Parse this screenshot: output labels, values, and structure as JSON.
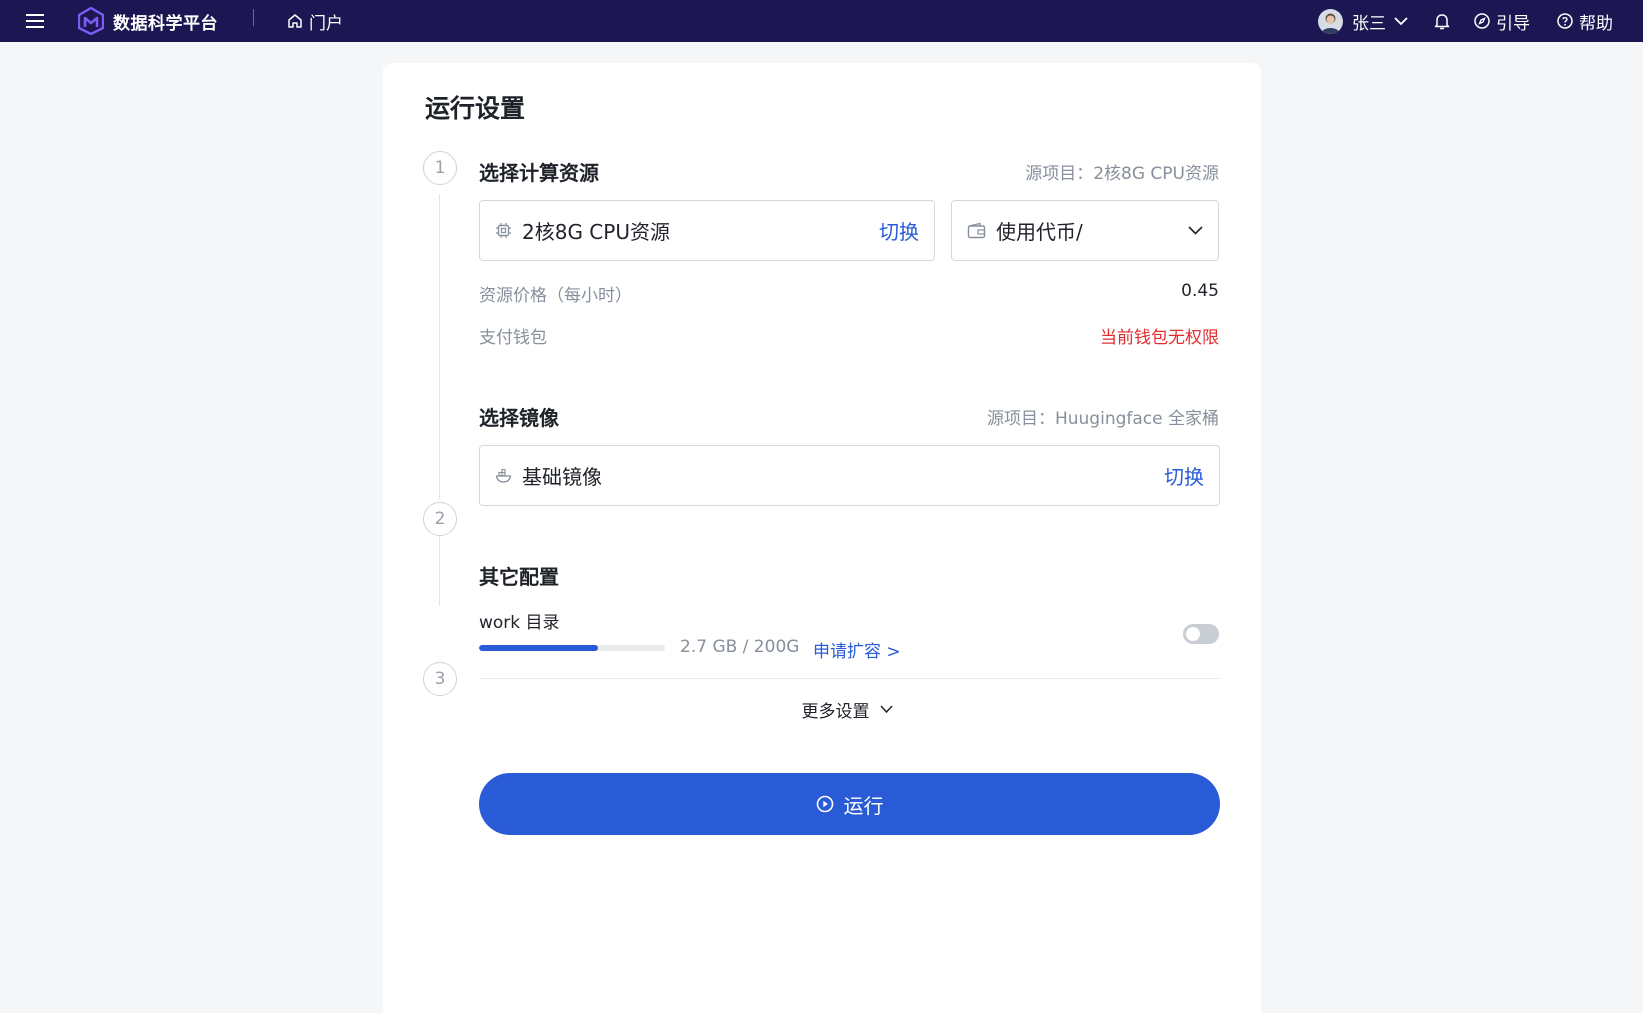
{
  "topbar": {
    "app_name": "数据科学平台",
    "portal_label": "门户",
    "user_name": "张三",
    "guide_label": "引导",
    "help_label": "帮助"
  },
  "card": {
    "title": "运行设置",
    "step1": {
      "number": "1",
      "title": "选择计算资源",
      "meta": "源项目：2核8G CPU资源",
      "resource": "2核8G CPU资源",
      "switch": "切换",
      "currency_select": "使用代币/",
      "price_label": "资源价格（每小时）",
      "price_value": "0.45",
      "wallet_label": "支付钱包",
      "wallet_value": "当前钱包无权限"
    },
    "step2": {
      "number": "2",
      "title": "选择镜像",
      "meta": "源项目：Huugingface 全家桶",
      "image": "基础镜像",
      "switch": "切换"
    },
    "step3": {
      "number": "3",
      "title": "其它配置",
      "work_label": "work 目录",
      "usage": "2.7 GB / 200G",
      "usage_fraction": 0.64,
      "expand": "申请扩容 >",
      "toggle_on": false,
      "more_settings": "更多设置"
    },
    "run_label": "运行"
  },
  "colors": {
    "topbar": "#1c1752",
    "accent": "#2a5bd7",
    "danger": "#e02d2d",
    "logo": "#7b5cf5"
  }
}
